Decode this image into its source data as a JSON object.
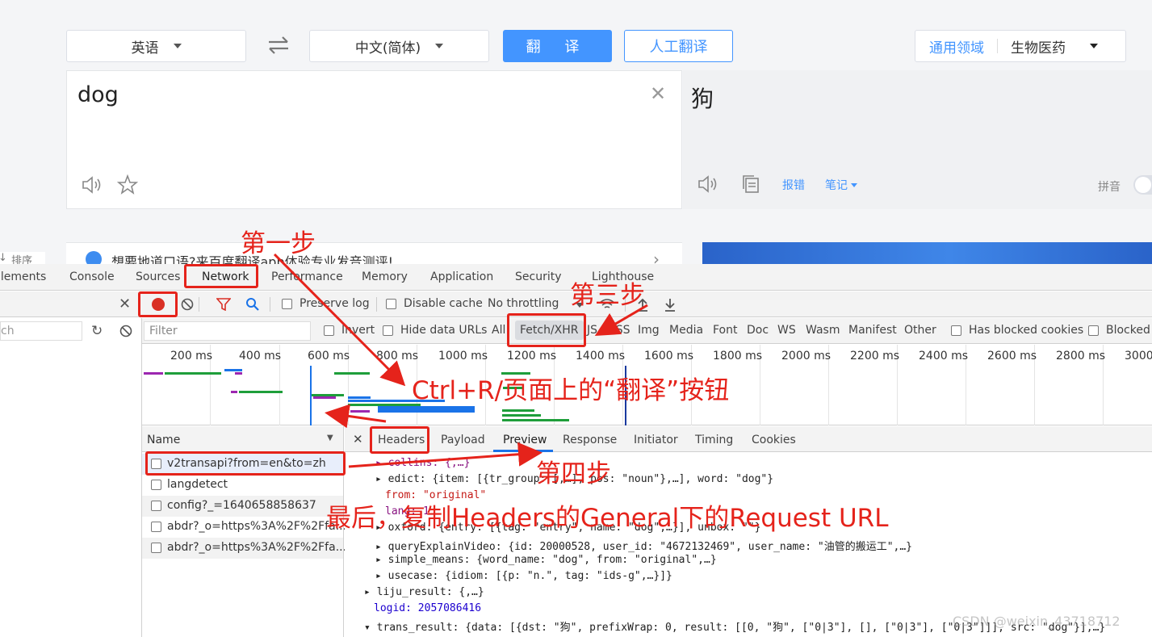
{
  "translator": {
    "source_lang": "英语",
    "target_lang": "中文(简体)",
    "translate_button": "翻 译",
    "human_translate_button": "人工翻译",
    "domain_general": "通用领域",
    "domain_selected": "生物医药",
    "source_text": "dog",
    "target_text": "狗",
    "report_error": "报错",
    "notes": "笔记",
    "pinyin": "拼音",
    "sort_label": "排序",
    "promo_text": "想要地道口语?来百度翻译app体验专业发音测评!"
  },
  "devtools": {
    "tabs": [
      "Elements",
      "Console",
      "Sources",
      "Network",
      "Performance",
      "Memory",
      "Application",
      "Security",
      "Lighthouse"
    ],
    "active_tab": "Network",
    "toolbar": {
      "preserve_log": "Preserve log",
      "disable_cache": "Disable cache",
      "throttling": "No throttling"
    },
    "search_placeholder": "ch",
    "filter": {
      "placeholder": "Filter",
      "invert": "Invert",
      "hide_data_urls": "Hide data URLs",
      "types": [
        "All",
        "Fetch/XHR",
        "JS",
        "CSS",
        "Img",
        "Media",
        "Font",
        "Doc",
        "WS",
        "Wasm",
        "Manifest",
        "Other"
      ],
      "active_type": "Fetch/XHR",
      "has_blocked_cookies": "Has blocked cookies",
      "blocked": "Blocked"
    },
    "timeline_ticks": [
      "200 ms",
      "400 ms",
      "600 ms",
      "800 ms",
      "1000 ms",
      "1200 ms",
      "1400 ms",
      "1600 ms",
      "1800 ms",
      "2000 ms",
      "2200 ms",
      "2400 ms",
      "2600 ms",
      "2800 ms",
      "3000"
    ],
    "name_header": "Name",
    "requests": [
      "v2transapi?from=en&to=zh",
      "langdetect",
      "config?_=1640658858637",
      "abdr?_o=https%3A%2F%2Ffa...",
      "abdr?_o=https%3A%2F%2Ffa..."
    ],
    "detail_tabs": [
      "Headers",
      "Payload",
      "Preview",
      "Response",
      "Initiator",
      "Timing",
      "Cookies"
    ],
    "active_detail_tab": "Preview",
    "preview_lines": [
      "▸ collins: {,…}",
      "▸ edict: {item: [{tr_group: [,…], pos: \"noun\"},…], word: \"dog\"}",
      "from: \"original\"",
      "lang: 1",
      "▸ oxford: {entry: [{tag: \"entry\", name: \"dog\",…}], unbox: \"\"}",
      "▸ queryExplainVideo: {id: 20000528, user_id: \"4672132469\", user_name: \"油管的搬运工\",…}",
      "▸ simple_means: {word_name: \"dog\", from: \"original\",…}",
      "▸ usecase: {idiom: [{p: \"n.\", tag: \"ids-g\",…}]}",
      "▸ liju_result: {,…}",
      "logid: 2057086416",
      "▾ trans_result: {data: [{dst: \"狗\", prefixWrap: 0, result: [[0, \"狗\", [\"0|3\"], [], [\"0|3\"], [\"0|3\"]]], src: \"dog\"}],…}"
    ]
  },
  "annotations": {
    "step1": "第一步",
    "step3": "第三步",
    "step_trigger": "Ctrl+R/页面上的“翻译”按钮",
    "step4": "第四步",
    "final": "最后，复制Headers的General下的Request URL"
  },
  "watermark": "CSDN @weixin_43718712",
  "colors": {
    "accent_blue": "#4395ff",
    "annotation_red": "#e5231b",
    "record_red": "#d93025"
  }
}
